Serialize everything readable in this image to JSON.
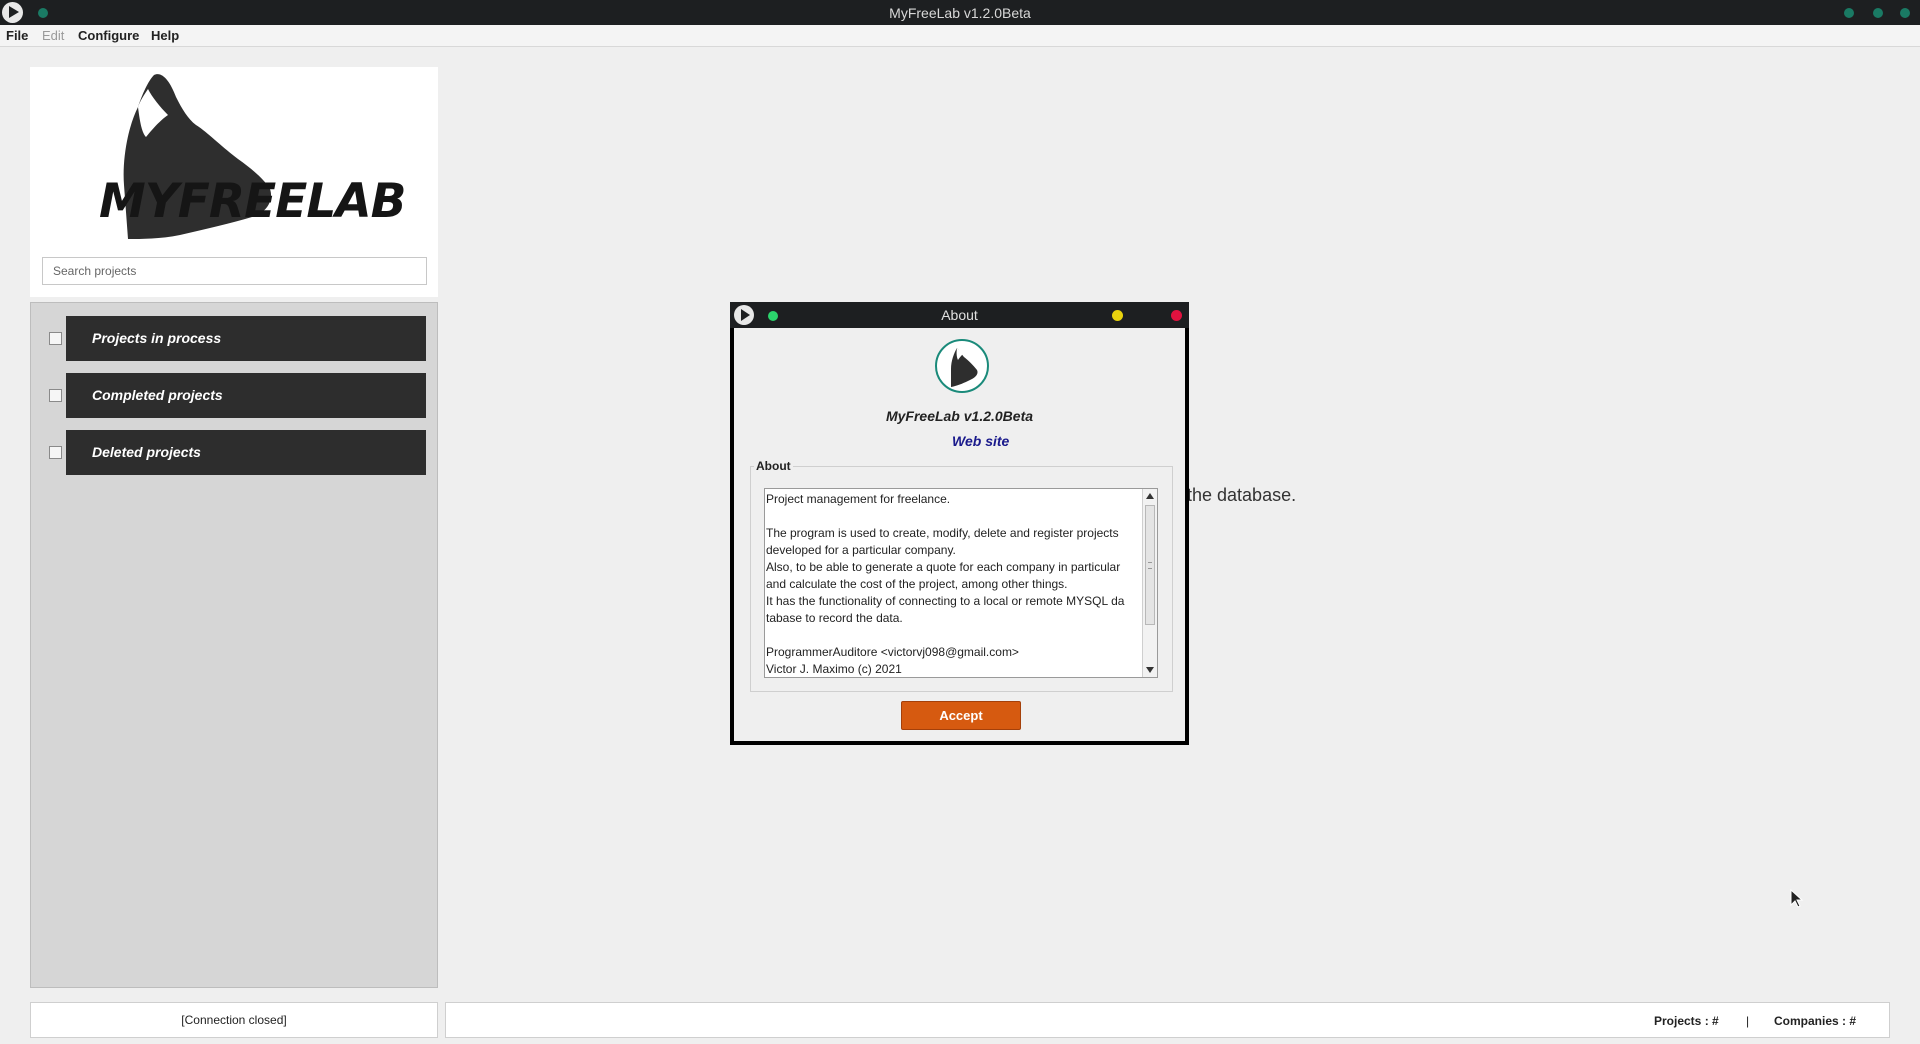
{
  "window": {
    "title": "MyFreeLab v1.2.0Beta"
  },
  "menu": {
    "file": "File",
    "edit": "Edit",
    "configure": "Configure",
    "help": "Help"
  },
  "sidebar": {
    "logo_text": "MYFREELAB",
    "search_placeholder": "Search projects",
    "categories": [
      {
        "label": "Projects in process",
        "checked": false
      },
      {
        "label": "Completed projects",
        "checked": false
      },
      {
        "label": "Deleted projects",
        "checked": false
      }
    ]
  },
  "main": {
    "background_message": "the database."
  },
  "status": {
    "connection": "[Connection closed]",
    "projects": "Projects : #",
    "separator": "|",
    "companies": "Companies : #"
  },
  "dialog": {
    "title": "About",
    "app_name": "MyFreeLab v1.2.0Beta",
    "website_link": "Web site",
    "group_label": "About",
    "about_lines": [
      "Project management for freelance.",
      "",
      "The program is used to create, modify, delete and register projects",
      "developed for a particular company.",
      "Also, to be able to generate a quote for each company in particular",
      "and calculate the cost of the project, among other things.",
      "It has the functionality of connecting to a local or remote MYSQL da",
      "tabase to record the data.",
      "",
      "ProgrammerAuditore <victorvj098@gmail.com>",
      "Victor J. Maximo (c) 2021"
    ],
    "accept_label": "Accept"
  },
  "colors": {
    "accent": "#d65a10",
    "link": "#1a1a8c",
    "titlebar": "#1d1f21",
    "category_bar": "#2d2d2d",
    "dialog_minimize": "#e8d20e",
    "dialog_close": "#e0123f",
    "dialog_status": "#2bd46c"
  },
  "icons": {
    "app": "play-icon",
    "logo": "wolf-head-logo",
    "cursor": "mouse-pointer-icon"
  }
}
